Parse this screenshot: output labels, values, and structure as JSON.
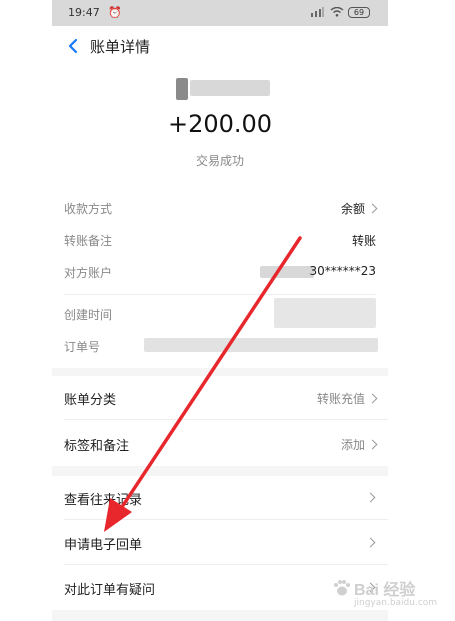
{
  "status_bar": {
    "time": "19:47",
    "battery": "69"
  },
  "nav": {
    "title": "账单详情"
  },
  "summary": {
    "amount": "+200.00",
    "status": "交易成功"
  },
  "details": [
    {
      "label": "收款方式",
      "value": "余额",
      "chevron": true
    },
    {
      "label": "转账备注",
      "value": "转账",
      "chevron": false
    },
    {
      "label": "对方账户",
      "value": "30******23",
      "chevron": false
    },
    {
      "label": "创建时间",
      "value": "",
      "chevron": false
    },
    {
      "label": "订单号",
      "value": "",
      "chevron": false
    }
  ],
  "card2": [
    {
      "label": "账单分类",
      "value": "转账充值"
    },
    {
      "label": "标签和备注",
      "value": "添加"
    }
  ],
  "card3": [
    {
      "label": "查看往来记录"
    },
    {
      "label": "申请电子回单"
    },
    {
      "label": "对此订单有疑问"
    }
  ],
  "watermark": {
    "brand": "Bai 经验",
    "url": "jingyan.baidu.com"
  },
  "colors": {
    "accent": "#1677ff",
    "annotation": "#e8272c"
  }
}
